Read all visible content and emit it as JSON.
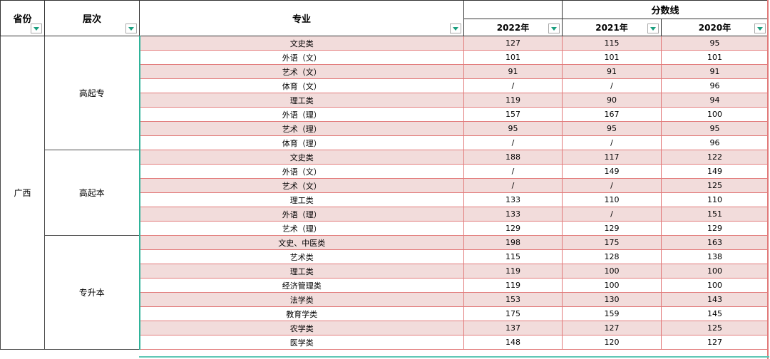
{
  "headers": {
    "province": "省份",
    "level": "层次",
    "major": "专业",
    "score_group": "分数线",
    "years": [
      "2022年",
      "2021年",
      "2020年"
    ]
  },
  "province": "广西",
  "groups": [
    {
      "level": "高起专",
      "rows": [
        {
          "major": "文史类",
          "y2022": "127",
          "y2021": "115",
          "y2020": "95"
        },
        {
          "major": "外语（文）",
          "y2022": "101",
          "y2021": "101",
          "y2020": "101"
        },
        {
          "major": "艺术（文）",
          "y2022": "91",
          "y2021": "91",
          "y2020": "91"
        },
        {
          "major": "体育（文）",
          "y2022": "/",
          "y2021": "/",
          "y2020": "96"
        },
        {
          "major": "理工类",
          "y2022": "119",
          "y2021": "90",
          "y2020": "94"
        },
        {
          "major": "外语（理）",
          "y2022": "157",
          "y2021": "167",
          "y2020": "100"
        },
        {
          "major": "艺术（理）",
          "y2022": "95",
          "y2021": "95",
          "y2020": "95"
        },
        {
          "major": "体育（理）",
          "y2022": "/",
          "y2021": "/",
          "y2020": "96"
        }
      ]
    },
    {
      "level": "高起本",
      "rows": [
        {
          "major": "文史类",
          "y2022": "188",
          "y2021": "117",
          "y2020": "122"
        },
        {
          "major": "外语（文）",
          "y2022": "/",
          "y2021": "149",
          "y2020": "149"
        },
        {
          "major": "艺术（文）",
          "y2022": "/",
          "y2021": "/",
          "y2020": "125"
        },
        {
          "major": "理工类",
          "y2022": "133",
          "y2021": "110",
          "y2020": "110"
        },
        {
          "major": "外语（理）",
          "y2022": "133",
          "y2021": "/",
          "y2020": "151"
        },
        {
          "major": "艺术（理）",
          "y2022": "129",
          "y2021": "129",
          "y2020": "129"
        }
      ]
    },
    {
      "level": "专升本",
      "rows": [
        {
          "major": "文史、中医类",
          "y2022": "198",
          "y2021": "175",
          "y2020": "163"
        },
        {
          "major": "艺术类",
          "y2022": "115",
          "y2021": "128",
          "y2020": "138"
        },
        {
          "major": "理工类",
          "y2022": "119",
          "y2021": "100",
          "y2020": "100"
        },
        {
          "major": "经济管理类",
          "y2022": "119",
          "y2021": "100",
          "y2020": "100"
        },
        {
          "major": "法学类",
          "y2022": "153",
          "y2021": "130",
          "y2020": "143"
        },
        {
          "major": "教育学类",
          "y2022": "175",
          "y2021": "159",
          "y2020": "145"
        },
        {
          "major": "农学类",
          "y2022": "137",
          "y2021": "127",
          "y2020": "125"
        },
        {
          "major": "医学类",
          "y2022": "148",
          "y2021": "120",
          "y2020": "127"
        }
      ]
    }
  ]
}
